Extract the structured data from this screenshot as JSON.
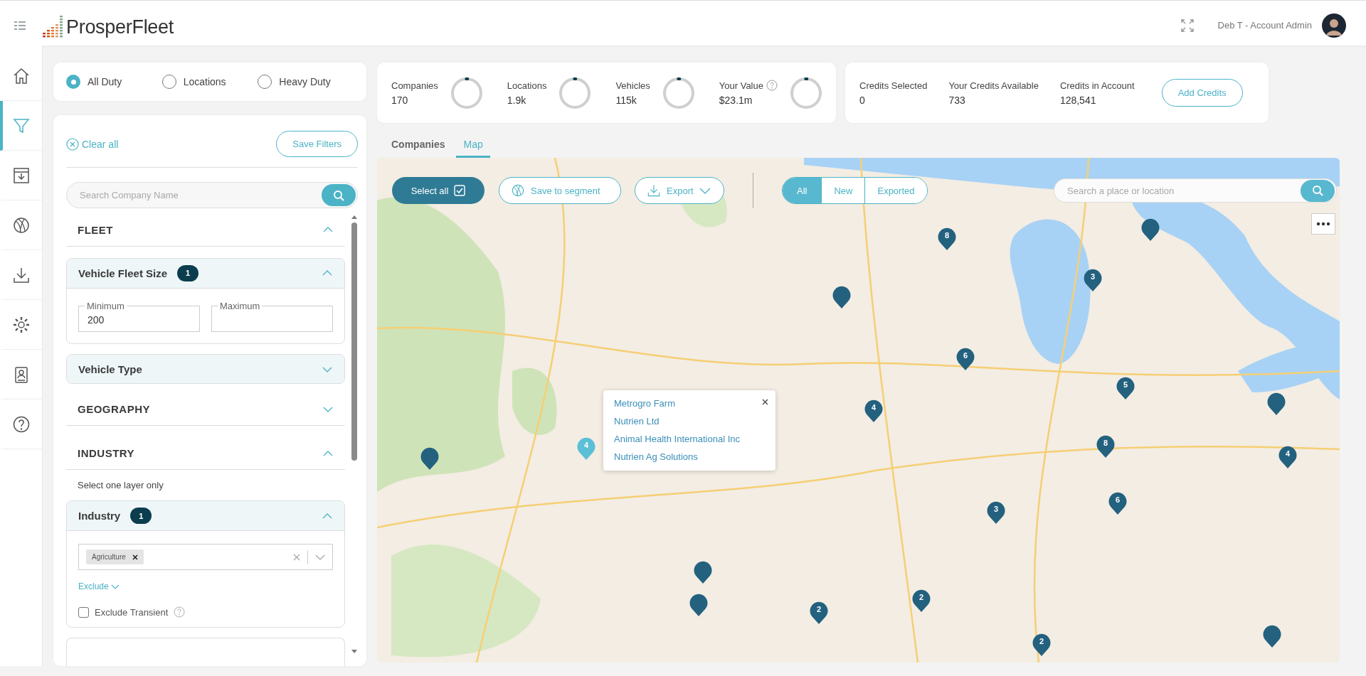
{
  "header": {
    "logo": "ProsperFleet",
    "user": "Deb T - Account Admin"
  },
  "rail": [
    {
      "selected": false
    },
    {
      "selected": true
    },
    {
      "selected": false
    },
    {
      "selected": false
    },
    {
      "selected": false
    },
    {
      "selected": false
    },
    {
      "selected": false
    },
    {
      "selected": false
    }
  ],
  "duty": [
    {
      "label": "All Duty",
      "selected": true
    },
    {
      "label": "Locations",
      "selected": false
    },
    {
      "label": "Heavy Duty",
      "selected": false
    }
  ],
  "filters": {
    "clear_all": "Clear all",
    "save": "Save Filters",
    "search_placeholder": "Search Company Name",
    "sections": [
      {
        "kind": "heading",
        "title": "FLEET",
        "expanded": true
      },
      {
        "kind": "group",
        "title": "Vehicle Fleet Size",
        "badge": "1",
        "expanded": true,
        "body": {
          "kind": "range",
          "fields": [
            {
              "label": "Minimum",
              "value": "200"
            },
            {
              "label": "Maximum"
            }
          ]
        }
      },
      {
        "kind": "group",
        "title": "Vehicle Type",
        "expanded": false
      },
      {
        "kind": "heading",
        "title": "GEOGRAPHY",
        "expanded": false
      },
      {
        "kind": "heading",
        "title": "INDUSTRY",
        "expanded": true
      },
      {
        "kind": "note",
        "text": "Select one layer only"
      },
      {
        "kind": "group",
        "title": "Industry",
        "badge": "1",
        "expanded": true,
        "body": {
          "kind": "multiselect",
          "tags": [
            "Agriculture"
          ],
          "exclude": "Exclude",
          "checkbox": {
            "label": "Exclude Transient",
            "checked": false
          }
        }
      },
      {
        "kind": "stub"
      }
    ]
  },
  "stats": [
    {
      "label": "Companies",
      "value": "170",
      "level": 0.01,
      "help": false
    },
    {
      "label": "Locations",
      "value": "1.9k",
      "level": 0.01,
      "help": false
    },
    {
      "label": "Vehicles",
      "value": "115k",
      "level": 0.01,
      "help": false
    },
    {
      "label": "Your Value",
      "value": "$23.1m",
      "level": 0.01,
      "help": true
    }
  ],
  "credits": [
    {
      "label": "Credits Selected",
      "value": "0"
    },
    {
      "label": "Your Credits Available",
      "value": "733"
    },
    {
      "label": "Credits in Account",
      "value": "128,541"
    }
  ],
  "add_credits": "Add Credits",
  "tabs": [
    {
      "label": "Companies",
      "selected": false
    },
    {
      "label": "Map",
      "selected": true
    }
  ],
  "map": {
    "select_all": "Select all",
    "save_segment": "Save to segment",
    "export": "Export",
    "view_filter": [
      {
        "label": "All",
        "selected": true
      },
      {
        "label": "New",
        "selected": false
      },
      {
        "label": "Exported",
        "selected": false
      }
    ],
    "search_placeholder": "Search a place or location",
    "markers": [
      {
        "count": "8",
        "selected": false
      },
      {
        "selected": false
      },
      {
        "count": "3",
        "selected": false
      },
      {
        "selected": false
      },
      {
        "count": "6",
        "selected": false
      },
      {
        "count": "5",
        "selected": false
      },
      {
        "count": "4",
        "selected": false
      },
      {
        "selected": false
      },
      {
        "count": "4",
        "selected": true
      },
      {
        "count": "8",
        "selected": false
      },
      {
        "count": "4",
        "selected": false
      },
      {
        "selected": false
      },
      {
        "count": "3",
        "selected": false
      },
      {
        "count": "6",
        "selected": false
      },
      {
        "selected": false
      },
      {
        "selected": false
      },
      {
        "count": "2",
        "selected": false
      },
      {
        "count": "2",
        "selected": false
      },
      {
        "count": "2",
        "selected": false
      },
      {
        "selected": false
      }
    ],
    "popup": {
      "items": [
        "Metrogro Farm",
        "Nutrien Ltd",
        "Animal Health International Inc",
        "Nutrien Ag Solutions"
      ]
    }
  }
}
